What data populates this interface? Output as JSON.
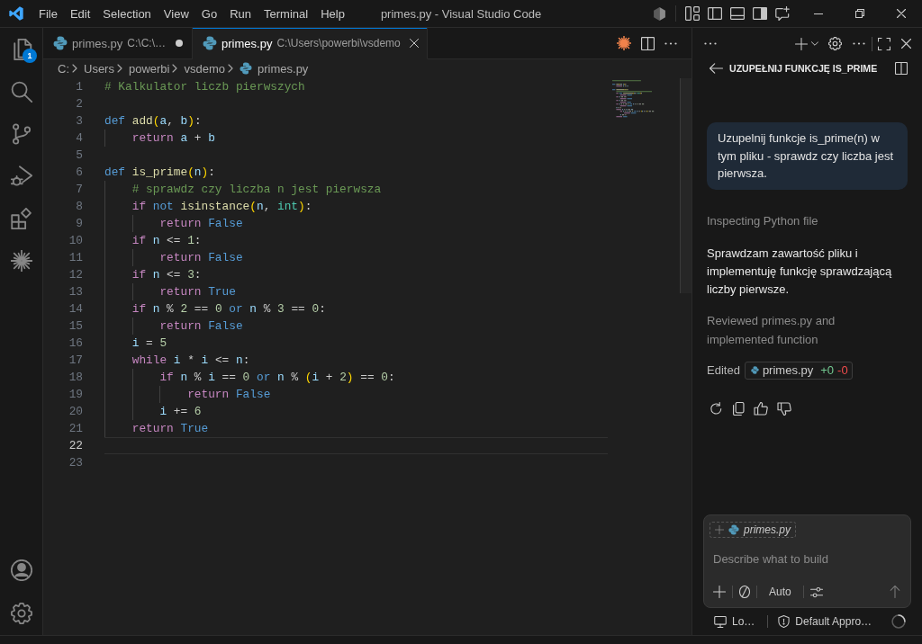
{
  "title_bar": {
    "menu": [
      "File",
      "Edit",
      "Selection",
      "View",
      "Go",
      "Run",
      "Terminal",
      "Help"
    ],
    "title": "primes.py - Visual Studio Code"
  },
  "activity_bar": {
    "explorer_badge": "1"
  },
  "editor": {
    "tabs": [
      {
        "label": "primes.py",
        "description": "C:\\C:\\…",
        "modified": true,
        "selected": false
      },
      {
        "label": "primes.py",
        "description": "C:\\Users\\powerbi\\vsdemo",
        "modified": false,
        "selected": true
      }
    ],
    "breadcrumb": [
      {
        "label": "C:",
        "kind": "folder"
      },
      {
        "label": "Users",
        "kind": "folder"
      },
      {
        "label": "powerbi",
        "kind": "folder"
      },
      {
        "label": "vsdemo",
        "kind": "folder"
      },
      {
        "label": "primes.py",
        "kind": "file"
      }
    ],
    "lines": [
      {
        "number": "1",
        "current": false,
        "tokens": [
          {
            "text": "# Kalkulator liczb pierwszych",
            "kind": "comment"
          }
        ]
      },
      {
        "number": "2",
        "current": false
      },
      {
        "number": "3",
        "current": false,
        "tokens": [
          {
            "text": "def",
            "kind": "keyword"
          },
          {
            "text": " add",
            "kind": "function"
          },
          {
            "text": "(",
            "kind": "bracket"
          },
          {
            "text": "a",
            "kind": "variable"
          },
          {
            "text": ", ",
            "kind": "plain"
          },
          {
            "text": "b",
            "kind": "variable"
          },
          {
            "text": ")",
            "kind": "bracket"
          },
          {
            "text": ":",
            "kind": "plain"
          }
        ]
      },
      {
        "number": "4",
        "current": false,
        "tokens": [
          {
            "text": "    return",
            "kind": "control"
          },
          {
            "text": " a",
            "kind": "variable"
          },
          {
            "text": " + ",
            "kind": "plain"
          },
          {
            "text": "b",
            "kind": "variable"
          }
        ]
      },
      {
        "number": "5",
        "current": false
      },
      {
        "number": "6",
        "current": false,
        "tokens": [
          {
            "text": "def",
            "kind": "keyword"
          },
          {
            "text": " is_prime",
            "kind": "function"
          },
          {
            "text": "(",
            "kind": "bracket"
          },
          {
            "text": "n",
            "kind": "variable"
          },
          {
            "text": ")",
            "kind": "bracket"
          },
          {
            "text": ":",
            "kind": "plain"
          }
        ]
      },
      {
        "number": "7",
        "current": false,
        "tokens": [
          {
            "text": "    # sprawdz czy liczba n jest pierwsza",
            "kind": "comment"
          }
        ]
      },
      {
        "number": "8",
        "current": false,
        "tokens": [
          {
            "text": "    if",
            "kind": "control"
          },
          {
            "text": " not",
            "kind": "keyword"
          },
          {
            "text": " isinstance",
            "kind": "function"
          },
          {
            "text": "(",
            "kind": "bracket"
          },
          {
            "text": "n",
            "kind": "variable"
          },
          {
            "text": ", ",
            "kind": "plain"
          },
          {
            "text": "int",
            "kind": "type"
          },
          {
            "text": ")",
            "kind": "bracket"
          },
          {
            "text": ":",
            "kind": "plain"
          }
        ]
      },
      {
        "number": "9",
        "current": false,
        "tokens": [
          {
            "text": "        return",
            "kind": "control"
          },
          {
            "text": " False",
            "kind": "keyword"
          }
        ]
      },
      {
        "number": "10",
        "current": false,
        "tokens": [
          {
            "text": "    if",
            "kind": "control"
          },
          {
            "text": " n",
            "kind": "variable"
          },
          {
            "text": " <= ",
            "kind": "plain"
          },
          {
            "text": "1",
            "kind": "number"
          },
          {
            "text": ":",
            "kind": "plain"
          }
        ]
      },
      {
        "number": "11",
        "current": false,
        "tokens": [
          {
            "text": "        return",
            "kind": "control"
          },
          {
            "text": " False",
            "kind": "keyword"
          }
        ]
      },
      {
        "number": "12",
        "current": false,
        "tokens": [
          {
            "text": "    if",
            "kind": "control"
          },
          {
            "text": " n",
            "kind": "variable"
          },
          {
            "text": " <= ",
            "kind": "plain"
          },
          {
            "text": "3",
            "kind": "number"
          },
          {
            "text": ":",
            "kind": "plain"
          }
        ]
      },
      {
        "number": "13",
        "current": false,
        "tokens": [
          {
            "text": "        return",
            "kind": "control"
          },
          {
            "text": " True",
            "kind": "keyword"
          }
        ]
      },
      {
        "number": "14",
        "current": false,
        "tokens": [
          {
            "text": "    if",
            "kind": "control"
          },
          {
            "text": " n",
            "kind": "variable"
          },
          {
            "text": " % ",
            "kind": "plain"
          },
          {
            "text": "2",
            "kind": "number"
          },
          {
            "text": " == ",
            "kind": "plain"
          },
          {
            "text": "0",
            "kind": "number"
          },
          {
            "text": " or",
            "kind": "keyword"
          },
          {
            "text": " n",
            "kind": "variable"
          },
          {
            "text": " % ",
            "kind": "plain"
          },
          {
            "text": "3",
            "kind": "number"
          },
          {
            "text": " == ",
            "kind": "plain"
          },
          {
            "text": "0",
            "kind": "number"
          },
          {
            "text": ":",
            "kind": "plain"
          }
        ]
      },
      {
        "number": "15",
        "current": false,
        "tokens": [
          {
            "text": "        return",
            "kind": "control"
          },
          {
            "text": " False",
            "kind": "keyword"
          }
        ]
      },
      {
        "number": "16",
        "current": false,
        "tokens": [
          {
            "text": "    i",
            "kind": "variable"
          },
          {
            "text": " = ",
            "kind": "plain"
          },
          {
            "text": "5",
            "kind": "number"
          }
        ]
      },
      {
        "number": "17",
        "current": false,
        "tokens": [
          {
            "text": "    while",
            "kind": "control"
          },
          {
            "text": " i",
            "kind": "variable"
          },
          {
            "text": " * ",
            "kind": "plain"
          },
          {
            "text": "i",
            "kind": "variable"
          },
          {
            "text": " <= ",
            "kind": "plain"
          },
          {
            "text": "n",
            "kind": "variable"
          },
          {
            "text": ":",
            "kind": "plain"
          }
        ]
      },
      {
        "number": "18",
        "current": false,
        "tokens": [
          {
            "text": "        if",
            "kind": "control"
          },
          {
            "text": " n",
            "kind": "variable"
          },
          {
            "text": " % ",
            "kind": "plain"
          },
          {
            "text": "i",
            "kind": "variable"
          },
          {
            "text": " == ",
            "kind": "plain"
          },
          {
            "text": "0",
            "kind": "number"
          },
          {
            "text": " or",
            "kind": "keyword"
          },
          {
            "text": " n",
            "kind": "variable"
          },
          {
            "text": " % ",
            "kind": "plain"
          },
          {
            "text": "(",
            "kind": "bracket"
          },
          {
            "text": "i",
            "kind": "variable"
          },
          {
            "text": " + ",
            "kind": "plain"
          },
          {
            "text": "2",
            "kind": "number"
          },
          {
            "text": ")",
            "kind": "bracket"
          },
          {
            "text": " == ",
            "kind": "plain"
          },
          {
            "text": "0",
            "kind": "number"
          },
          {
            "text": ":",
            "kind": "plain"
          }
        ]
      },
      {
        "number": "19",
        "current": false,
        "tokens": [
          {
            "text": "            return",
            "kind": "control"
          },
          {
            "text": " False",
            "kind": "keyword"
          }
        ]
      },
      {
        "number": "20",
        "current": false,
        "tokens": [
          {
            "text": "        i",
            "kind": "variable"
          },
          {
            "text": " += ",
            "kind": "plain"
          },
          {
            "text": "6",
            "kind": "number"
          }
        ]
      },
      {
        "number": "21",
        "current": false,
        "tokens": [
          {
            "text": "    return",
            "kind": "control"
          },
          {
            "text": " True",
            "kind": "keyword"
          }
        ]
      },
      {
        "number": "22",
        "current": true
      },
      {
        "number": "23",
        "current": false
      }
    ]
  },
  "chat": {
    "title": "UZUPEŁNIJ FUNKCJĘ IS_PRIME",
    "user_message": "Uzupelnij funkcje is_prime(n) w tym pliku - sprawdz czy liczba jest pierwsza.",
    "progress": "Inspecting Python file",
    "response": "Sprawdzam zawartość pliku i implementuję funkcję sprawdzającą liczby pierwsze.",
    "summary": "Reviewed primes.py and implemented function",
    "edited": {
      "label": "Edited",
      "file": "primes.py",
      "added": "+0",
      "removed": "-0"
    },
    "input": {
      "attachment": "primes.py",
      "placeholder": "Describe what to build",
      "mode": "Auto"
    },
    "footer": {
      "location": "Lo…",
      "approvals": "Default Appro…"
    }
  }
}
